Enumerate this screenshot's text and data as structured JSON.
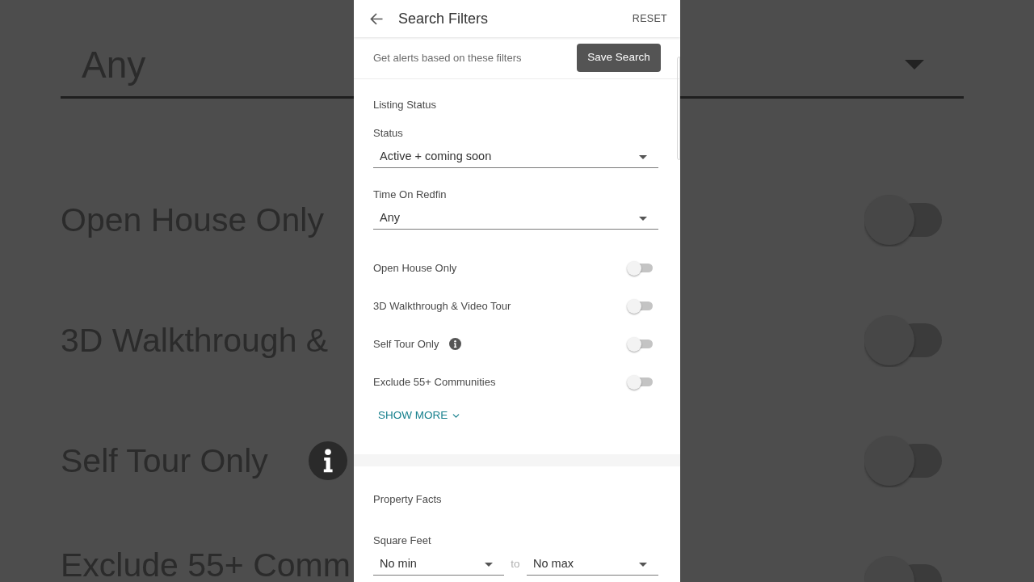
{
  "backdrop": {
    "time_value": "Any",
    "toggles": [
      {
        "label": "Open House Only",
        "on": false,
        "info_icon": false
      },
      {
        "label": "3D Walkthrough &",
        "on": false,
        "info_icon": false
      },
      {
        "label": "Self Tour Only",
        "on": false,
        "info_icon": true
      },
      {
        "label": "Exclude 55+ Comm",
        "on": false,
        "info_icon": false
      }
    ]
  },
  "header": {
    "title": "Search Filters",
    "reset": "RESET"
  },
  "alerts": {
    "text": "Get alerts based on these filters",
    "button": "Save Search"
  },
  "listing_status": {
    "heading": "Listing Status",
    "dropdowns": [
      {
        "label": "Status",
        "value": "Active + coming soon"
      },
      {
        "label": "Time On Redfin",
        "value": "Any"
      }
    ],
    "toggles": [
      {
        "label": "Open House Only",
        "on": false,
        "info_icon": false
      },
      {
        "label": "3D Walkthrough & Video Tour",
        "on": false,
        "info_icon": false
      },
      {
        "label": "Self Tour Only",
        "on": false,
        "info_icon": true
      },
      {
        "label": "Exclude 55+ Communities",
        "on": false,
        "info_icon": false
      }
    ],
    "show_more": "SHOW MORE"
  },
  "property_facts": {
    "heading": "Property Facts",
    "square_feet": {
      "label": "Square Feet",
      "min": "No min",
      "separator": "to",
      "max": "No max"
    }
  }
}
